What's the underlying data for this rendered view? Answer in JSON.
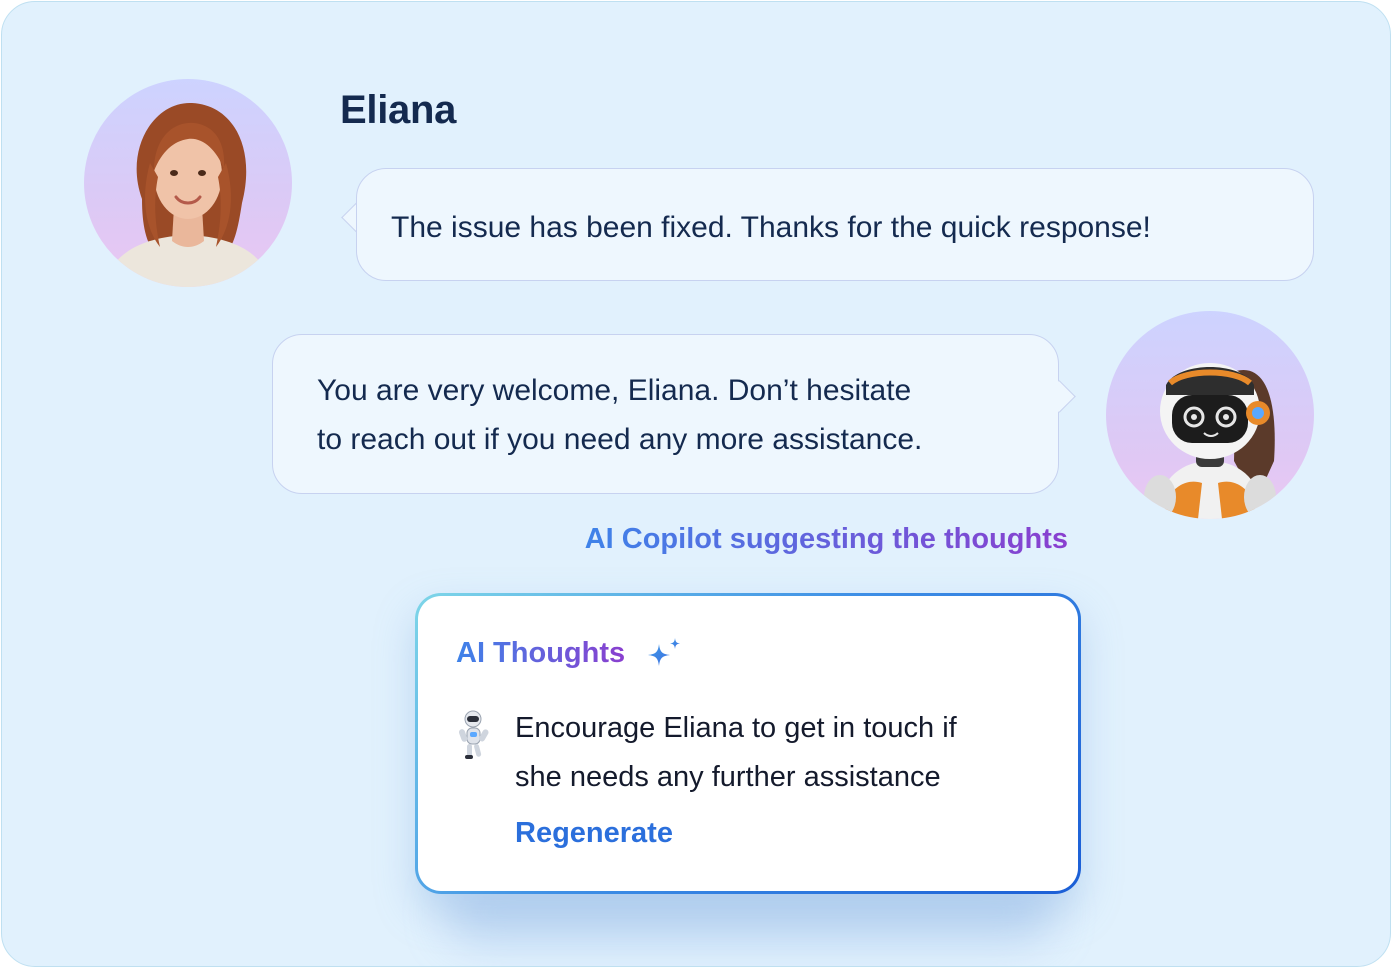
{
  "conversation": {
    "user_name": "Eliana",
    "user_message": "The issue has been fixed. Thanks for the quick response!",
    "bot_message_line1": "You are very welcome, Eliana. Don’t hesitate",
    "bot_message_line2": "to reach out if you need any more assistance."
  },
  "copilot": {
    "label": "AI Copilot suggesting the thoughts"
  },
  "ai_thoughts": {
    "title": "AI Thoughts",
    "suggestion_line1": "Encourage Eliana to get in touch if",
    "suggestion_line2": "she needs any further assistance",
    "regenerate_label": "Regenerate"
  },
  "icons": {
    "user_avatar": "woman-avatar",
    "bot_avatar": "robot-avatar",
    "sparkle": "sparkle-icon",
    "mini_robot": "robot-icon"
  },
  "colors": {
    "background": "#e1f1fd",
    "bubble": "#eef7fe",
    "text": "#142a4f",
    "accent_blue": "#2b6fdc",
    "gradient_start": "#3e83e9",
    "gradient_end": "#8a3fcf"
  }
}
